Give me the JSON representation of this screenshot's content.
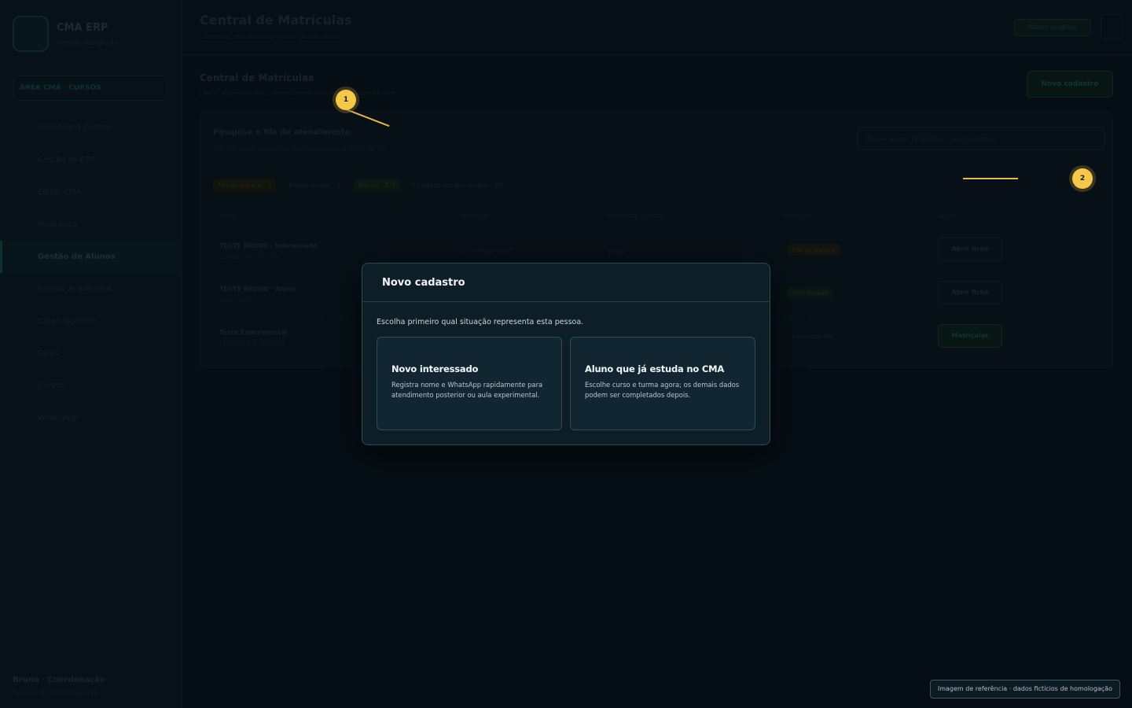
{
  "sidebar": {
    "brand": "CMA ERP",
    "brand_sub": "Gestão integrada",
    "section": "ÁREA CMA · CURSOS",
    "items": [
      {
        "label": "Dashboard Central"
      },
      {
        "label": "Gestão de ERP"
      },
      {
        "label": "Editar CMA"
      },
      {
        "label": "Relatórios"
      },
      {
        "label": "Gestão de Alunos"
      },
      {
        "label": "Gestão Acadêmica"
      },
      {
        "label": "Corpo Docente"
      },
      {
        "label": "Salas"
      },
      {
        "label": "Cursos"
      },
      {
        "label": "WhatsApp"
      }
    ],
    "active_index": 4,
    "footer_name": "Bruno · Coordenação",
    "footer_role": "Sessão de homologação"
  },
  "topbar": {
    "title": "Central de Matrículas",
    "subtitle": "Captação, atendimento e inscrição de alunos",
    "action": "Novos usuários"
  },
  "page": {
    "title": "Central de Matrículas",
    "subtitle": "Leads, experimentais, alunos ativos e contatos encaminhados",
    "new_button": "Novo cadastro"
  },
  "panel": {
    "title": "Pesquisa e fila de atendimento",
    "subtitle": "Filtre os leads depois de cada pessoa para o fim da fila",
    "search_placeholder": "Buscar aluno, WhatsApp, curso ou turma",
    "chips": [
      "Fila de espera · 3",
      "Experimental · 1",
      "Alunos · 1/1",
      "Contatos encaminhados · 08"
    ],
    "headers": [
      "NOME",
      "WHATSAPP",
      "INTERESSE / CURSO",
      "SITUAÇÃO",
      "AÇÕES"
    ],
    "rows": [
      {
        "name": "TESTE BRUNO · Interessado",
        "sub": "Contato por indicação",
        "phone": "(11) 99000-0007",
        "course": "Violão",
        "status": "Fila de espera",
        "action": "Abrir ficha"
      },
      {
        "name": "TESTE BRUNO · Aluno",
        "sub": "Aluno ativo",
        "phone": "",
        "course": "",
        "status": "Matriculado",
        "action": "Abrir ficha"
      },
      {
        "name": "Teste Experimental",
        "sub": "Experimental agendada",
        "phone": "",
        "course": "",
        "status": "Experimental",
        "action": "Matricular"
      }
    ]
  },
  "modal": {
    "title": "Novo cadastro",
    "intro": "Escolha primeiro qual situação representa esta pessoa.",
    "options": [
      {
        "title": "Novo interessado",
        "desc": "Registra nome e WhatsApp rapidamente para atendimento posterior ou aula experimental."
      },
      {
        "title": "Aluno que já estuda no CMA",
        "desc": "Escolhe curso e turma agora; os demais dados podem ser completados depois."
      }
    ]
  },
  "annotations": {
    "marker_1": "1",
    "marker_2": "2",
    "accent_color": "#f5c84a"
  },
  "reference_note": "Imagem de referência · dados fictícios de homologação"
}
